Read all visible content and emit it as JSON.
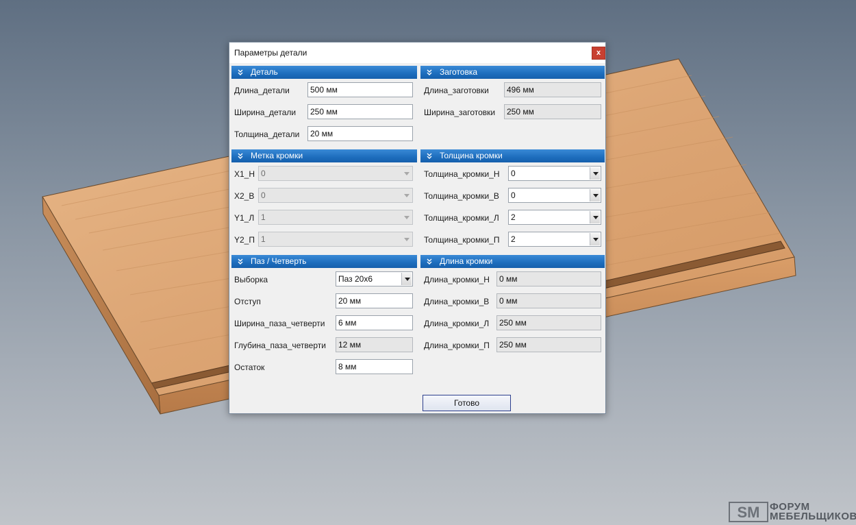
{
  "dialog": {
    "title": "Параметры детали",
    "close_label": "x",
    "ok_label": "Готово"
  },
  "sections": {
    "detail": {
      "header": "Деталь",
      "rows": [
        {
          "label": "Длина_детали",
          "value": "500 мм"
        },
        {
          "label": "Ширина_детали",
          "value": "250 мм"
        },
        {
          "label": "Толщина_детали",
          "value": "20 мм"
        }
      ]
    },
    "blank": {
      "header": "Заготовка",
      "rows": [
        {
          "label": "Длина_заготовки",
          "value": "496 мм"
        },
        {
          "label": "Ширина_заготовки",
          "value": "250 мм"
        }
      ]
    },
    "edge_mark": {
      "header": "Метка кромки",
      "rows": [
        {
          "label": "X1_Н",
          "value": "0"
        },
        {
          "label": "X2_В",
          "value": "0"
        },
        {
          "label": "Y1_Л",
          "value": "1"
        },
        {
          "label": "Y2_П",
          "value": "1"
        }
      ]
    },
    "edge_thickness": {
      "header": "Толщина кромки",
      "rows": [
        {
          "label": "Толщина_кромки_Н",
          "value": "0"
        },
        {
          "label": "Толщина_кромки_В",
          "value": "0"
        },
        {
          "label": "Толщина_кромки_Л",
          "value": "2"
        },
        {
          "label": "Толщина_кромки_П",
          "value": "2"
        }
      ]
    },
    "groove": {
      "header": "Паз / Четверть",
      "rows": [
        {
          "label": "Выборка",
          "value": "Паз 20х6"
        },
        {
          "label": "Отступ",
          "value": "20 мм"
        },
        {
          "label": "Ширина_паза_четверти",
          "value": "6 мм"
        },
        {
          "label": "Глубина_паза_четверти",
          "value": "12 мм"
        },
        {
          "label": "Остаток",
          "value": "8 мм"
        }
      ]
    },
    "edge_length": {
      "header": "Длина кромки",
      "rows": [
        {
          "label": "Длина_кромки_Н",
          "value": "0 мм"
        },
        {
          "label": "Длина_кромки_В",
          "value": "0 мм"
        },
        {
          "label": "Длина_кромки_Л",
          "value": "250 мм"
        },
        {
          "label": "Длина_кромки_П",
          "value": "250 мм"
        }
      ]
    }
  },
  "watermark": {
    "logo_text": "SM",
    "line1": "ФОРУМ",
    "line2": "МЕБЕЛЬЩИКОВ"
  },
  "colors": {
    "section_header": "#1f6fbf",
    "close_button": "#c84031",
    "wood": "#d9a16c"
  }
}
